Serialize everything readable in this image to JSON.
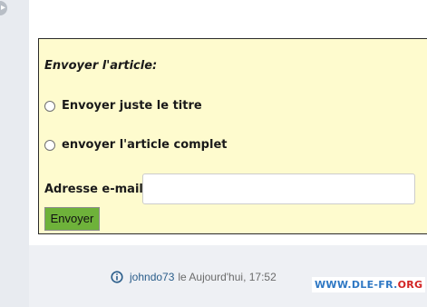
{
  "form": {
    "title": "Envoyer l'article:",
    "options": [
      {
        "label": "Envoyer juste le titre",
        "selected": false
      },
      {
        "label": "envoyer l'article complet",
        "selected": false
      }
    ],
    "email_label": "Adresse e-mail:",
    "email_value": "",
    "submit_label": "Envoyer"
  },
  "footer": {
    "author": "johndo73",
    "date": "le Aujourd'hui, 17:52"
  },
  "watermark": {
    "main": "WWW.DLE-FR.",
    "suffix": "ORG"
  },
  "colors": {
    "panel_bg": "#fefbce",
    "button_bg": "#6eb23a",
    "author_link": "#2a5d8a",
    "watermark_blue": "#2f78c4",
    "watermark_red": "#d22222"
  }
}
